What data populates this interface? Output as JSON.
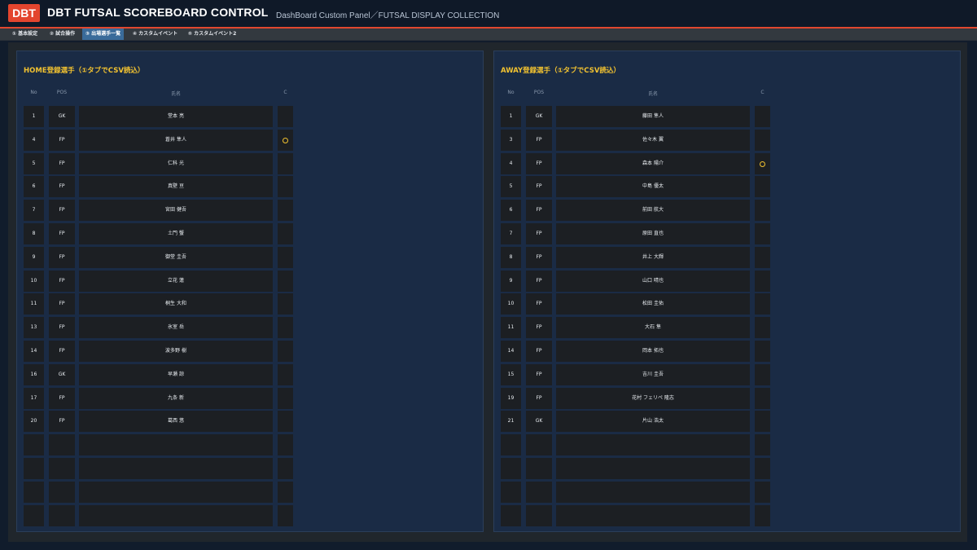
{
  "header": {
    "logo": "DBT",
    "title": "DBT FUTSAL SCOREBOARD CONTROL",
    "subtitle": "DashBoard Custom Panel／FUTSAL DISPLAY COLLECTION"
  },
  "tabs": [
    {
      "label": "① 基本設定",
      "active": false
    },
    {
      "label": "② 試合操作",
      "active": false
    },
    {
      "label": "③ 出場選手一覧",
      "active": true
    },
    {
      "label": "④ カスタムイベント",
      "active": false
    },
    {
      "label": "⑤ カスタムイベント2",
      "active": false
    }
  ],
  "colors": {
    "accent": "#e3452e",
    "title_yellow": "#f2c230",
    "panel_bg": "#1a2b45",
    "cell_bg": "#1c1f23",
    "tab_active": "#3a6b9a"
  },
  "columns": {
    "no": "No",
    "pos": "POS",
    "name": "氏名",
    "c": "C"
  },
  "home": {
    "title": "HOME登録選手（①タブでCSV読込）",
    "players": [
      {
        "no": "1",
        "pos": "GK",
        "name": "堂本 亮",
        "captain": false
      },
      {
        "no": "4",
        "pos": "FP",
        "name": "蒼井 隼人",
        "captain": true
      },
      {
        "no": "5",
        "pos": "FP",
        "name": "仁科 光",
        "captain": false
      },
      {
        "no": "6",
        "pos": "FP",
        "name": "真壁 亘",
        "captain": false
      },
      {
        "no": "7",
        "pos": "FP",
        "name": "宮田 健吾",
        "captain": false
      },
      {
        "no": "8",
        "pos": "FP",
        "name": "土門 蟹",
        "captain": false
      },
      {
        "no": "9",
        "pos": "FP",
        "name": "御堂 圭吾",
        "captain": false
      },
      {
        "no": "10",
        "pos": "FP",
        "name": "立花 蓮",
        "captain": false
      },
      {
        "no": "11",
        "pos": "FP",
        "name": "桐生 大和",
        "captain": false
      },
      {
        "no": "13",
        "pos": "FP",
        "name": "氷室 岳",
        "captain": false
      },
      {
        "no": "14",
        "pos": "FP",
        "name": "波多野 樹",
        "captain": false
      },
      {
        "no": "16",
        "pos": "GK",
        "name": "早瀬 諒",
        "captain": false
      },
      {
        "no": "17",
        "pos": "FP",
        "name": "九条 新",
        "captain": false
      },
      {
        "no": "20",
        "pos": "FP",
        "name": "葛西 悠",
        "captain": false
      },
      {
        "no": "",
        "pos": "",
        "name": "",
        "captain": false
      },
      {
        "no": "",
        "pos": "",
        "name": "",
        "captain": false
      },
      {
        "no": "",
        "pos": "",
        "name": "",
        "captain": false
      },
      {
        "no": "",
        "pos": "",
        "name": "",
        "captain": false
      }
    ]
  },
  "away": {
    "title": "AWAY登録選手（①タブでCSV読込）",
    "players": [
      {
        "no": "1",
        "pos": "GK",
        "name": "藤田 隼人",
        "captain": false
      },
      {
        "no": "3",
        "pos": "FP",
        "name": "佐々木 翼",
        "captain": false
      },
      {
        "no": "4",
        "pos": "FP",
        "name": "森本 陽介",
        "captain": true
      },
      {
        "no": "5",
        "pos": "FP",
        "name": "中島 優太",
        "captain": false
      },
      {
        "no": "6",
        "pos": "FP",
        "name": "前田 航大",
        "captain": false
      },
      {
        "no": "7",
        "pos": "FP",
        "name": "原田 直也",
        "captain": false
      },
      {
        "no": "8",
        "pos": "FP",
        "name": "井上 大輝",
        "captain": false
      },
      {
        "no": "9",
        "pos": "FP",
        "name": "山口 晴也",
        "captain": false
      },
      {
        "no": "10",
        "pos": "FP",
        "name": "松田 圭佑",
        "captain": false
      },
      {
        "no": "11",
        "pos": "FP",
        "name": "大石 隼",
        "captain": false
      },
      {
        "no": "14",
        "pos": "FP",
        "name": "岡本 拓也",
        "captain": false
      },
      {
        "no": "15",
        "pos": "FP",
        "name": "吉川 圭吾",
        "captain": false
      },
      {
        "no": "19",
        "pos": "FP",
        "name": "花村 フェリペ 隆志",
        "captain": false
      },
      {
        "no": "21",
        "pos": "GK",
        "name": "片山 浩太",
        "captain": false
      },
      {
        "no": "",
        "pos": "",
        "name": "",
        "captain": false
      },
      {
        "no": "",
        "pos": "",
        "name": "",
        "captain": false
      },
      {
        "no": "",
        "pos": "",
        "name": "",
        "captain": false
      },
      {
        "no": "",
        "pos": "",
        "name": "",
        "captain": false
      }
    ]
  }
}
